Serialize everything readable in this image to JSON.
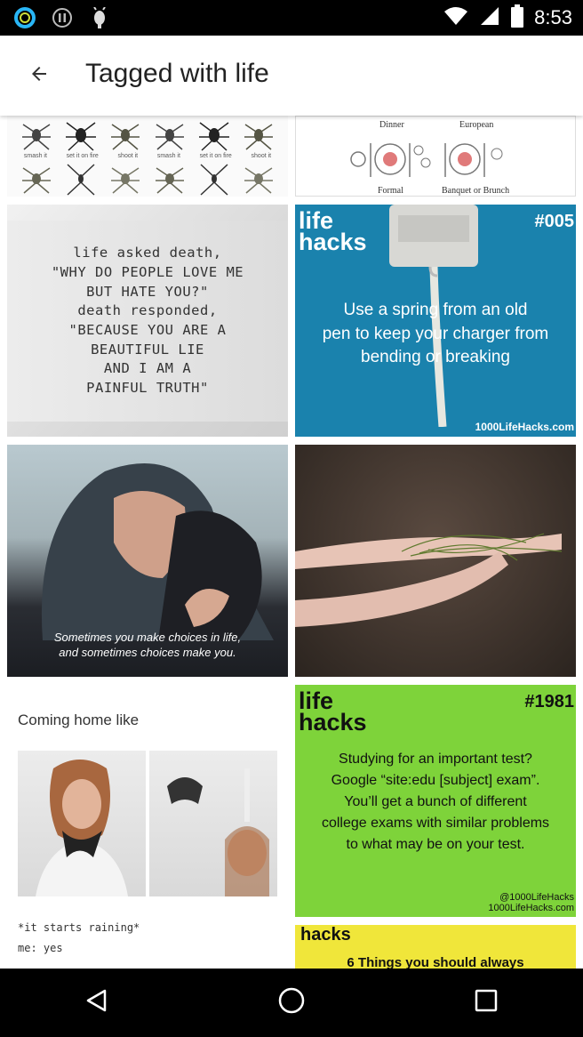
{
  "status_bar": {
    "time": "8:53",
    "left_icons": [
      "ring-app-icon",
      "info-icon",
      "android-bug-icon"
    ],
    "right_icons": [
      "wifi-icon",
      "signal-icon",
      "battery-icon"
    ]
  },
  "app_bar": {
    "title": "Tagged with life",
    "back_icon": "arrow-back-icon"
  },
  "tiles": {
    "spiders": {
      "labels": [
        "smash it",
        "set it on fire",
        "shoot it",
        "smash it",
        "set it on fire",
        "shoot it"
      ]
    },
    "dinner": {
      "top_labels": [
        "Dinner",
        "European"
      ],
      "bottom_labels": [
        "Formal",
        "Banquet or Brunch"
      ]
    },
    "quote": {
      "text": "life asked death,\n\"WHY DO PEOPLE LOVE ME\nBUT HATE YOU?\"\ndeath responded,\n\"BECAUSE YOU ARE A\nBEAUTIFUL LIE\nAND I AM A\nPAINFUL TRUTH\""
    },
    "lifehack_charger": {
      "head": "life\nhacks",
      "number": "#005",
      "body": "Use a spring from an old\npen to keep your charger from\nbending or breaking",
      "footer": "1000LifeHacks.com"
    },
    "kiss": {
      "caption": "Sometimes you make choices in life,\nand sometimes choices make you."
    },
    "coming_home": {
      "title": "Coming home like",
      "caption": "*it starts raining*\nme: yes"
    },
    "lifehack_study": {
      "head": "life\nhacks",
      "number": "#1981",
      "body": "Studying for an important test?\nGoogle “site:edu [subject] exam”.\nYou’ll get a bunch of different\ncollege exams with similar problems\nto what may be on your test.",
      "footer": "@1000LifeHacks\n1000LifeHacks.com"
    },
    "lifehack_things": {
      "head": "hacks",
      "body": "6 Things you should always"
    }
  },
  "nav_bar": {
    "buttons": [
      "back-nav-icon",
      "home-nav-icon",
      "recents-nav-icon"
    ]
  },
  "colors": {
    "blue_hack": "#1a82ad",
    "green_hack": "#7ed33a",
    "yellow_hack": "#f0e63a",
    "status_bar": "#000000"
  }
}
